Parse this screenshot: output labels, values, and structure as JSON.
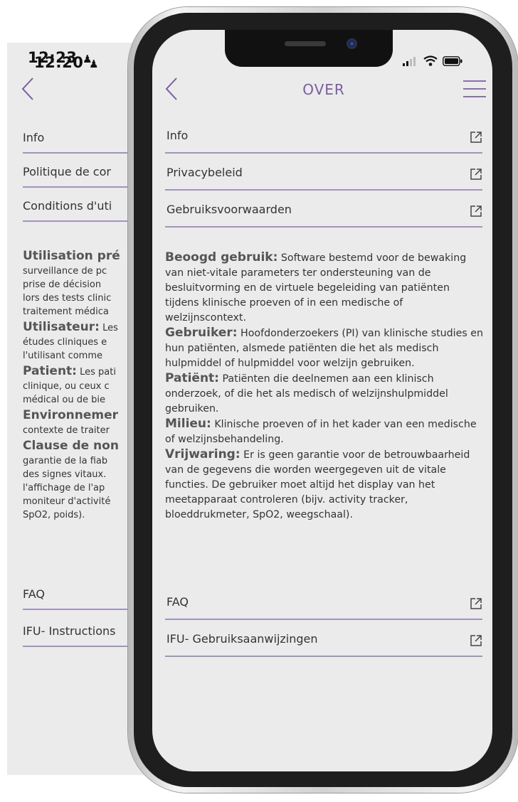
{
  "background_screen": {
    "time": "12:20",
    "rows": [
      "Info",
      "Politique de cor",
      "Conditions d'uti"
    ],
    "paragraphs": [
      {
        "heading": "Utilisation pré",
        "lines": [
          "surveillance de pc",
          "prise de décision",
          "lors des tests clinic",
          "traitement médica"
        ]
      },
      {
        "heading": "Utilisateur:",
        "first": "Les",
        "lines": [
          "études cliniques e",
          "l'utilisant comme"
        ]
      },
      {
        "heading": "Patient:",
        "first": "Les pati",
        "lines": [
          "clinique, ou ceux c",
          "médical ou de bie"
        ]
      },
      {
        "heading": "Environnemer",
        "lines": [
          "contexte de traiter"
        ]
      },
      {
        "heading": "Clause de non",
        "lines": [
          "garantie de la fiab",
          "des signes vitaux.",
          "l'affichage de l'ap",
          "moniteur d'activité",
          "SpO2, poids)."
        ]
      }
    ],
    "bottom_rows": [
      "FAQ",
      "IFU- Instructions"
    ]
  },
  "status_bar": {
    "time": "12:23"
  },
  "header": {
    "title": "OVER"
  },
  "links": [
    {
      "label": "Info"
    },
    {
      "label": "Privacybeleid"
    },
    {
      "label": "Gebruiksvoorwaarden"
    }
  ],
  "sections": [
    {
      "heading": "Beoogd gebruik:",
      "text": "Software bestemd voor de bewaking van niet-vitale parameters ter ondersteuning van de besluitvorming en de virtuele begeleiding van patiënten tijdens klinische proeven of in een medische of welzijnscontext."
    },
    {
      "heading": "Gebruiker:",
      "text": "Hoofdonderzoekers (PI) van klinische studies en hun patiënten, alsmede patiënten die het als medisch hulpmiddel of hulpmiddel voor welzijn gebruiken."
    },
    {
      "heading": "Patiënt:",
      "text": "Patiënten die deelnemen aan een klinisch onderzoek, of die het als medisch of welzijnshulpmiddel gebruiken."
    },
    {
      "heading": "Milieu:",
      "text": "Klinische proeven of in het kader van een medische of welzijnsbehandeling."
    },
    {
      "heading": "Vrijwaring:",
      "text": "Er is geen garantie voor de betrouwbaarheid van de gegevens die worden weergegeven uit de vitale functies. De gebruiker moet altijd het display van het meetapparaat controleren (bijv. activity tracker, bloeddrukmeter, SpO2, weegschaal)."
    }
  ],
  "bottom_links": [
    {
      "label": "FAQ"
    },
    {
      "label": "IFU- Gebruiksaanwijzingen"
    }
  ],
  "colors": {
    "accent": "#7a5ea2",
    "divider": "#a393bb",
    "screen_bg": "#ebebeb"
  }
}
